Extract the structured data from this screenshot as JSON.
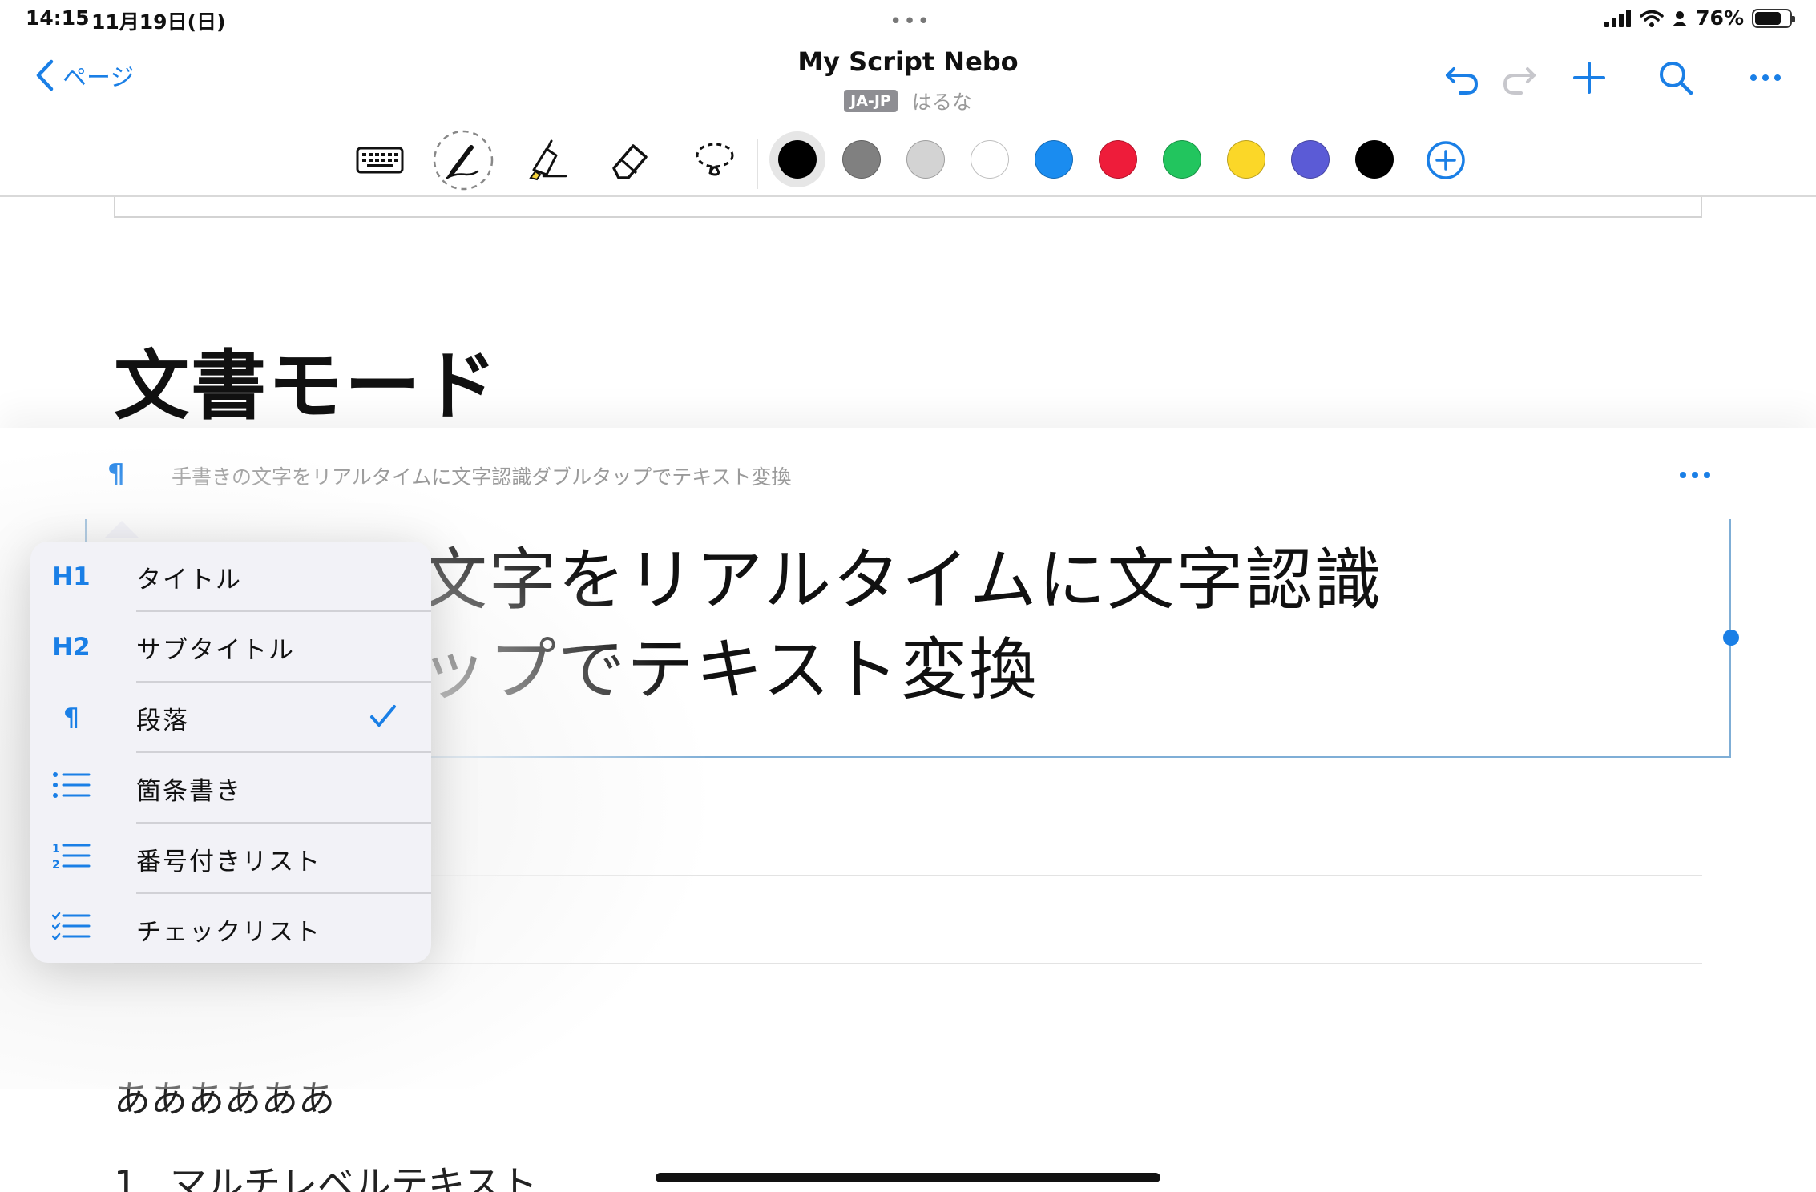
{
  "status_bar": {
    "time": "14:15",
    "date": "11月19日(日)",
    "more_dots": "•••",
    "battery_percent": "76%",
    "battery_level": 0.76
  },
  "nav": {
    "back_label": "ページ",
    "title": "My Script Nebo",
    "language_badge": "JA-JP",
    "subtitle": "はるな"
  },
  "toolbar": {
    "tools": [
      "keyboard-icon",
      "pen-icon",
      "highlighter-icon",
      "eraser-icon",
      "lasso-icon"
    ],
    "selected_tool": "pen-icon",
    "colors": [
      "#000000",
      "#808080",
      "#d3d3d3",
      "#ffffff",
      "#1a8cf0",
      "#ee1c3a",
      "#22c55e",
      "#fbd728",
      "#5b5bd6",
      "#000000"
    ],
    "selected_color_index": 0
  },
  "document": {
    "heading": "文書モード",
    "block_preview": "手書きの文字をリアルタイムに文字認識ダブルタップでテキスト変換",
    "block_text_line1": "手書きの文字をリアルタイムに文字認識",
    "block_text_line2": "ダブルタップでテキスト変換",
    "paragraph": "ああああああ",
    "list_number": "1",
    "list_item": "マルチレベルテキスト"
  },
  "block_menu": {
    "items": [
      {
        "icon": "H1",
        "label": "タイトル",
        "checked": false
      },
      {
        "icon": "H2",
        "label": "サブタイトル",
        "checked": false
      },
      {
        "icon": "¶",
        "label": "段落",
        "checked": true
      },
      {
        "icon": "bulleted-list-icon",
        "label": "箇条書き",
        "checked": false
      },
      {
        "icon": "numbered-list-icon",
        "label": "番号付きリスト",
        "checked": false
      },
      {
        "icon": "checklist-icon",
        "label": "チェックリスト",
        "checked": false
      }
    ]
  },
  "colors": {
    "accent": "#1a7fe6",
    "menu_bg": "#f2f2f7"
  }
}
